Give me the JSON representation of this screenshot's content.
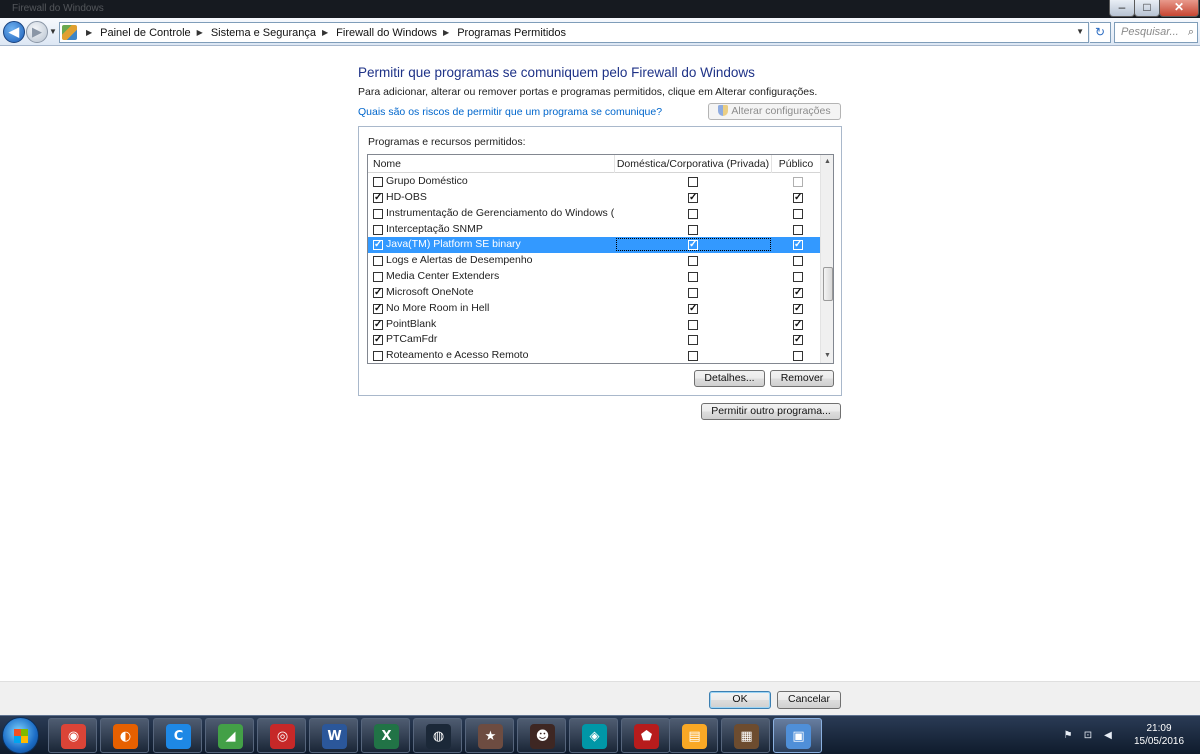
{
  "window": {
    "title_ghost": "Firewall do Windows",
    "min_glyph": "–",
    "max_glyph": "□",
    "close_glyph": "✕"
  },
  "nav": {
    "breadcrumb": [
      "Painel de Controle",
      "Sistema e Segurança",
      "Firewall do Windows",
      "Programas Permitidos"
    ],
    "search_placeholder": "Pesquisar...",
    "back_glyph": "◀",
    "forward_glyph": "▶",
    "refresh_glyph": "↻",
    "search_glyph": "⌕"
  },
  "content": {
    "title": "Permitir que programas se comuniquem pelo Firewall do Windows",
    "description": "Para adicionar, alterar ou remover portas e programas permitidos, clique em Alterar configurações.",
    "risk_link": "Quais são os riscos de permitir que um programa se comunique?",
    "change_settings_label": "Alterar configurações"
  },
  "programs": {
    "group_label": "Programas e recursos permitidos:",
    "columns": {
      "name": "Nome",
      "private": "Doméstica/Corporativa (Privada)",
      "public": "Público"
    },
    "rows": [
      {
        "name": "Grupo Doméstico",
        "enabled": false,
        "private": false,
        "public": false,
        "public_dim": true
      },
      {
        "name": "HD-OBS",
        "enabled": true,
        "private": true,
        "public": true
      },
      {
        "name": "Instrumentação de Gerenciamento do Windows (...",
        "enabled": false,
        "private": false,
        "public": false
      },
      {
        "name": "Interceptação SNMP",
        "enabled": false,
        "private": false,
        "public": false
      },
      {
        "name": "Java(TM) Platform SE binary",
        "enabled": true,
        "private": true,
        "public": true,
        "selected": true
      },
      {
        "name": "Logs e Alertas de Desempenho",
        "enabled": false,
        "private": false,
        "public": false
      },
      {
        "name": "Media Center Extenders",
        "enabled": false,
        "private": false,
        "public": false
      },
      {
        "name": "Microsoft OneNote",
        "enabled": true,
        "private": false,
        "public": true
      },
      {
        "name": "No More Room in Hell",
        "enabled": true,
        "private": true,
        "public": true
      },
      {
        "name": "PointBlank",
        "enabled": true,
        "private": false,
        "public": true
      },
      {
        "name": "PTCamFdr",
        "enabled": true,
        "private": false,
        "public": true
      },
      {
        "name": "Roteamento e Acesso Remoto",
        "enabled": false,
        "private": false,
        "public": false
      }
    ],
    "details_label": "Detalhes...",
    "remove_label": "Remover",
    "allow_other_label": "Permitir outro programa..."
  },
  "footer": {
    "ok_label": "OK",
    "cancel_label": "Cancelar"
  },
  "taskbar": {
    "apps": [
      {
        "name": "chrome",
        "glyph": "◉",
        "color": "#db4437"
      },
      {
        "name": "firefox",
        "glyph": "◐",
        "color": "#e66000"
      },
      {
        "name": "ccleaner",
        "glyph": "C",
        "color": "#1e88e5"
      },
      {
        "name": "excel-viewer",
        "glyph": "◢",
        "color": "#43a047"
      },
      {
        "name": "photo-app",
        "glyph": "◎",
        "color": "#c62828"
      },
      {
        "name": "word",
        "glyph": "W",
        "color": "#2b579a"
      },
      {
        "name": "excel",
        "glyph": "X",
        "color": "#217346"
      },
      {
        "name": "steam",
        "glyph": "◍",
        "color": "#1b2838"
      },
      {
        "name": "game-launcher",
        "glyph": "★",
        "color": "#6d4c41"
      },
      {
        "name": "game-character",
        "glyph": "☻",
        "color": "#3e2723"
      },
      {
        "name": "network-tool",
        "glyph": "◈",
        "color": "#0097a7"
      },
      {
        "name": "shield-game",
        "glyph": "⬟",
        "color": "#b71c1c"
      },
      {
        "name": "file-explorer",
        "glyph": "▤",
        "color": "#f9a825"
      },
      {
        "name": "minecraft",
        "glyph": "▦",
        "color": "#6d4c2f"
      },
      {
        "name": "control-panel",
        "glyph": "▣",
        "color": "#4f8fd8"
      }
    ],
    "time": "21:09",
    "date": "15/05/2016"
  }
}
